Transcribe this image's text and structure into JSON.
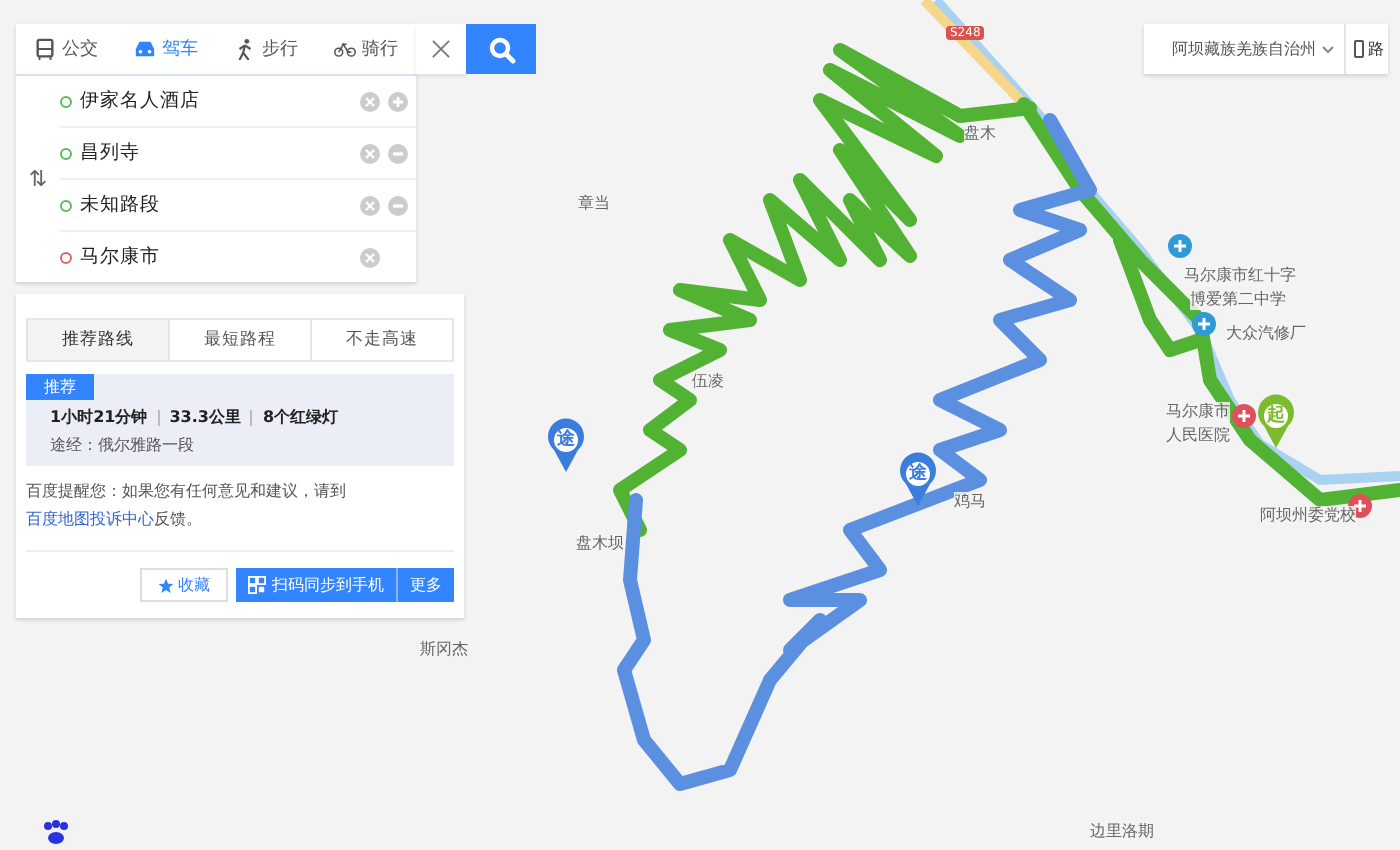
{
  "modes": [
    {
      "label": "公交",
      "selected": false
    },
    {
      "label": "驾车",
      "selected": true
    },
    {
      "label": "步行",
      "selected": false
    },
    {
      "label": "骑行",
      "selected": false
    }
  ],
  "stops": [
    {
      "name": "伊家名人酒店",
      "kind": "start"
    },
    {
      "name": "昌列寺",
      "kind": "via"
    },
    {
      "name": "未知路段",
      "kind": "via"
    },
    {
      "name": "马尔康市",
      "kind": "end"
    }
  ],
  "swap_glyph": "⇅",
  "route_tabs": [
    {
      "label": "推荐路线",
      "selected": true
    },
    {
      "label": "最短路程",
      "selected": false
    },
    {
      "label": "不走高速",
      "selected": false
    }
  ],
  "route": {
    "badge": "推荐",
    "duration": "1小时21分钟",
    "distance": "33.3公里",
    "lights": "8个红绿灯",
    "via": "途经：俄尔雅路一段"
  },
  "notice": {
    "text": "百度提醒您：如果您有任何意见和建议，请到",
    "link": "百度地图投诉中心",
    "tail": "反馈。"
  },
  "buttons": {
    "favorite": "收藏",
    "sync": "扫码同步到手机",
    "more": "更多"
  },
  "city": "阿坝藏族羌族自治州",
  "road_label": "路",
  "map": {
    "road_shield": "S248",
    "places": [
      "盘木",
      "章当",
      "伍凌",
      "盘木坝",
      "斯冈杰",
      "边里洛期",
      "马尔康市红十字",
      "博爱第二中学",
      "大众汽修厂",
      "马尔康市",
      "人民医院",
      "阿坝州委党校",
      "鸡马"
    ],
    "pois": [
      {
        "kind": "hospital"
      },
      {
        "kind": "school"
      },
      {
        "kind": "redcross"
      },
      {
        "kind": "garage"
      }
    ],
    "pins": [
      {
        "glyph": "途",
        "kind": "via"
      },
      {
        "glyph": "途",
        "kind": "via"
      },
      {
        "glyph": "起",
        "kind": "start"
      }
    ]
  }
}
